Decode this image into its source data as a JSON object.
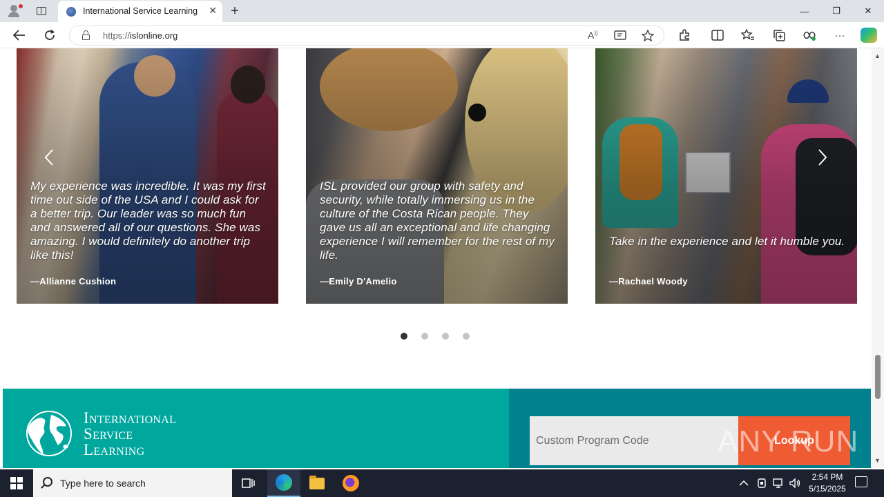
{
  "browser": {
    "tab_title": "International Service Learning",
    "url_protocol": "https://",
    "url_host": "islonline.org",
    "new_tab_symbol": "+",
    "tab_close_symbol": "✕",
    "window_controls": {
      "minimize": "—",
      "restore": "❐",
      "close": "✕"
    },
    "icons": [
      "profile-icon",
      "tab-actions-icon",
      "back-icon",
      "refresh-icon",
      "lock-icon",
      "read-aloud-icon",
      "immersive-reader-icon",
      "favorite-star-icon",
      "extensions-icon",
      "split-screen-icon",
      "favorites-icon",
      "collections-icon",
      "browser-essentials-icon",
      "more-icon",
      "copilot-icon"
    ]
  },
  "testimonials": [
    {
      "quote": "My experience was incredible. It was my first time out side of the USA and I could ask for a better trip. Our leader was so much fun and answered all of our questions. She was amazing. I would definitely do another trip like this!",
      "author": "—Allianne Cushion"
    },
    {
      "quote": "ISL provided our group with safety and security, while totally immersing us in the culture of the Costa Rican people. They gave us all an exceptional and life changing experience I will remember for the rest of my life.",
      "author": "—Emily D'Amelio"
    },
    {
      "quote": "Take in the experience and let it humble you.",
      "author": "—Rachael Woody"
    }
  ],
  "carousel": {
    "prev_symbol": "‹",
    "next_symbol": "›",
    "dot_count": 4,
    "active_dot": 1
  },
  "footer": {
    "logo_line1": "International",
    "logo_line2": "Service",
    "logo_line3": "Learning",
    "code_placeholder": "Custom Program Code",
    "lookup_label": "Lookup",
    "watermark": "ANY RUN",
    "colors": {
      "left": "#00a79d",
      "right": "#00818d",
      "button": "#ef5b32"
    }
  },
  "taskbar": {
    "search_placeholder": "Type here to search",
    "time": "2:54 PM",
    "date": "5/15/2025",
    "icons": [
      "windows-start-icon",
      "search-icon",
      "task-view-icon",
      "edge-icon",
      "file-explorer-icon",
      "firefox-icon",
      "chevron-up-icon",
      "network-icon",
      "volume-icon",
      "notification-icon"
    ]
  }
}
